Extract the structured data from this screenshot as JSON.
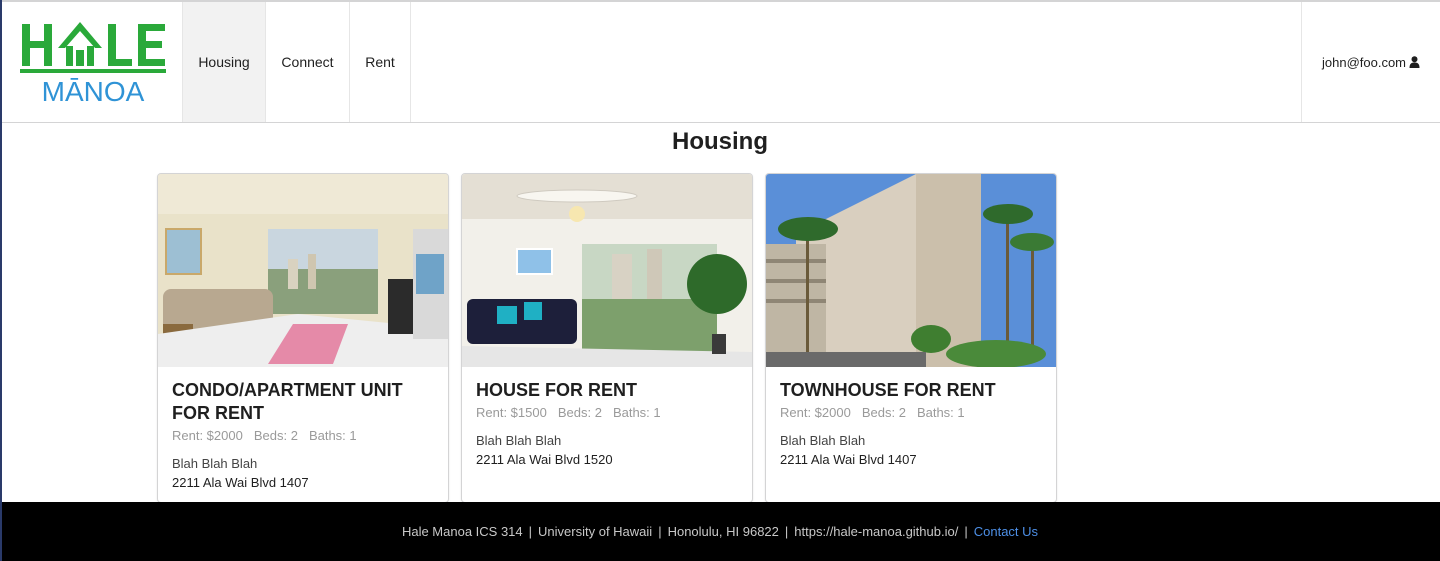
{
  "brand": {
    "logo_top": "HALE",
    "logo_bottom": "MĀNOA",
    "green": "#2aa93a",
    "blue": "#2f93d6"
  },
  "nav": {
    "items": [
      {
        "label": "Housing",
        "active": true
      },
      {
        "label": "Connect",
        "active": false
      },
      {
        "label": "Rent",
        "active": false
      }
    ],
    "user": "john@foo.com",
    "user_icon": "user-icon"
  },
  "page": {
    "title": "Housing"
  },
  "listings": [
    {
      "title": "CONDO/APARTMENT UNIT FOR RENT",
      "rent": "Rent: $2000",
      "beds": "Beds: 2",
      "baths": "Baths: 1",
      "description": "Blah Blah Blah",
      "address": "2211 Ala Wai Blvd 1407"
    },
    {
      "title": "HOUSE FOR RENT",
      "rent": "Rent: $1500",
      "beds": "Beds: 2",
      "baths": "Baths: 1",
      "description": "Blah Blah Blah",
      "address": "2211 Ala Wai Blvd 1520"
    },
    {
      "title": "TOWNHOUSE FOR RENT",
      "rent": "Rent: $2000",
      "beds": "Beds: 2",
      "baths": "Baths: 1",
      "description": "Blah Blah Blah",
      "address": "2211 Ala Wai Blvd 1407"
    }
  ],
  "footer": {
    "items": [
      "Hale Manoa ICS 314",
      "University of Hawaii",
      "Honolulu, HI 96822",
      "https://hale-manoa.github.io/"
    ],
    "contact": "Contact Us",
    "separator": "|",
    "link_color": "#4d8fe6"
  }
}
